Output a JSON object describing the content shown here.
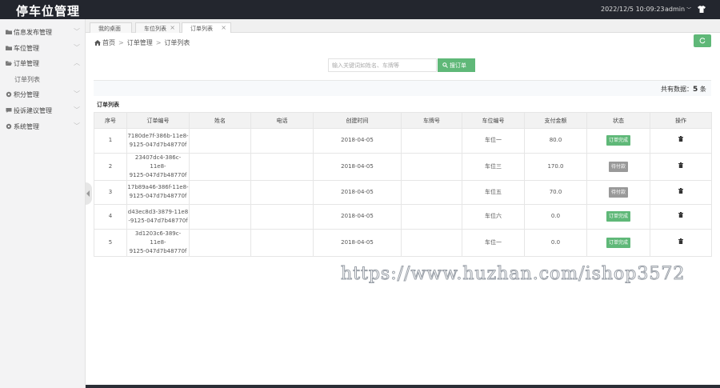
{
  "header": {
    "title": "停车位管理",
    "datetime": "2022/12/5 10:09:23",
    "user": "admin"
  },
  "sidebar": {
    "items": [
      {
        "label": "信息发布管理",
        "icon": "folder-icon"
      },
      {
        "label": "车位管理",
        "icon": "folder-icon"
      },
      {
        "label": "订单管理",
        "icon": "folder-open-icon"
      },
      {
        "label": "积分管理",
        "icon": "gear-icon"
      },
      {
        "label": "投诉建议管理",
        "icon": "chat-icon"
      },
      {
        "label": "系统管理",
        "icon": "gear-icon"
      }
    ],
    "sub_item": "订单列表"
  },
  "tabs": [
    {
      "label": "我的桌面"
    },
    {
      "label": "车位列表"
    },
    {
      "label": "订单列表"
    }
  ],
  "breadcrumb": {
    "home": "首页",
    "level1": "订单管理",
    "level2": "订单列表"
  },
  "search": {
    "placeholder": "输入关键词如姓名、车牌等",
    "button": "搜订单"
  },
  "summary": {
    "label": "共有数据：",
    "count": "5",
    "unit": "条"
  },
  "list_title": "订单列表",
  "table": {
    "columns": [
      "序号",
      "订单编号",
      "姓名",
      "电话",
      "创建时间",
      "车牌号",
      "车位编号",
      "支付金额",
      "状态",
      "操作"
    ],
    "rows": [
      {
        "seq": "1",
        "order_no_1": "7180de7f-386b-11e8-",
        "order_no_2": "9125-047d7b48770f",
        "name": "",
        "phone": "",
        "created": "2018-04-05",
        "plate": "",
        "spot": "车位一",
        "amount": "80.0",
        "status": "订单完成",
        "status_type": "done"
      },
      {
        "seq": "2",
        "order_no_1": "23407dc4-386c-11e8-",
        "order_no_2": "9125-047d7b48770f",
        "name": "",
        "phone": "",
        "created": "2018-04-05",
        "plate": "",
        "spot": "车位三",
        "amount": "170.0",
        "status": "待付款",
        "status_type": "pending"
      },
      {
        "seq": "3",
        "order_no_1": "17b89a46-386f-11e8-",
        "order_no_2": "9125-047d7b48770f",
        "name": "",
        "phone": "",
        "created": "2018-04-05",
        "plate": "",
        "spot": "车位五",
        "amount": "70.0",
        "status": "待付款",
        "status_type": "pending"
      },
      {
        "seq": "4",
        "order_no_1": "d43ec8d3-3879-11e8",
        "order_no_2": "-9125-047d7b48770f",
        "name": "",
        "phone": "",
        "created": "2018-04-05",
        "plate": "",
        "spot": "车位六",
        "amount": "0.0",
        "status": "订单完成",
        "status_type": "done"
      },
      {
        "seq": "5",
        "order_no_1": "3d1203c6-389c-11e8-",
        "order_no_2": "9125-047d7b48770f",
        "name": "",
        "phone": "",
        "created": "2018-04-05",
        "plate": "",
        "spot": "车位一",
        "amount": "0.0",
        "status": "订单完成",
        "status_type": "done"
      }
    ]
  },
  "watermark": "https://www.huzhan.com/ishop3572",
  "colors": {
    "topbar": "#23262e",
    "accent_green": "#5fb878",
    "pending_gray": "#999999"
  }
}
